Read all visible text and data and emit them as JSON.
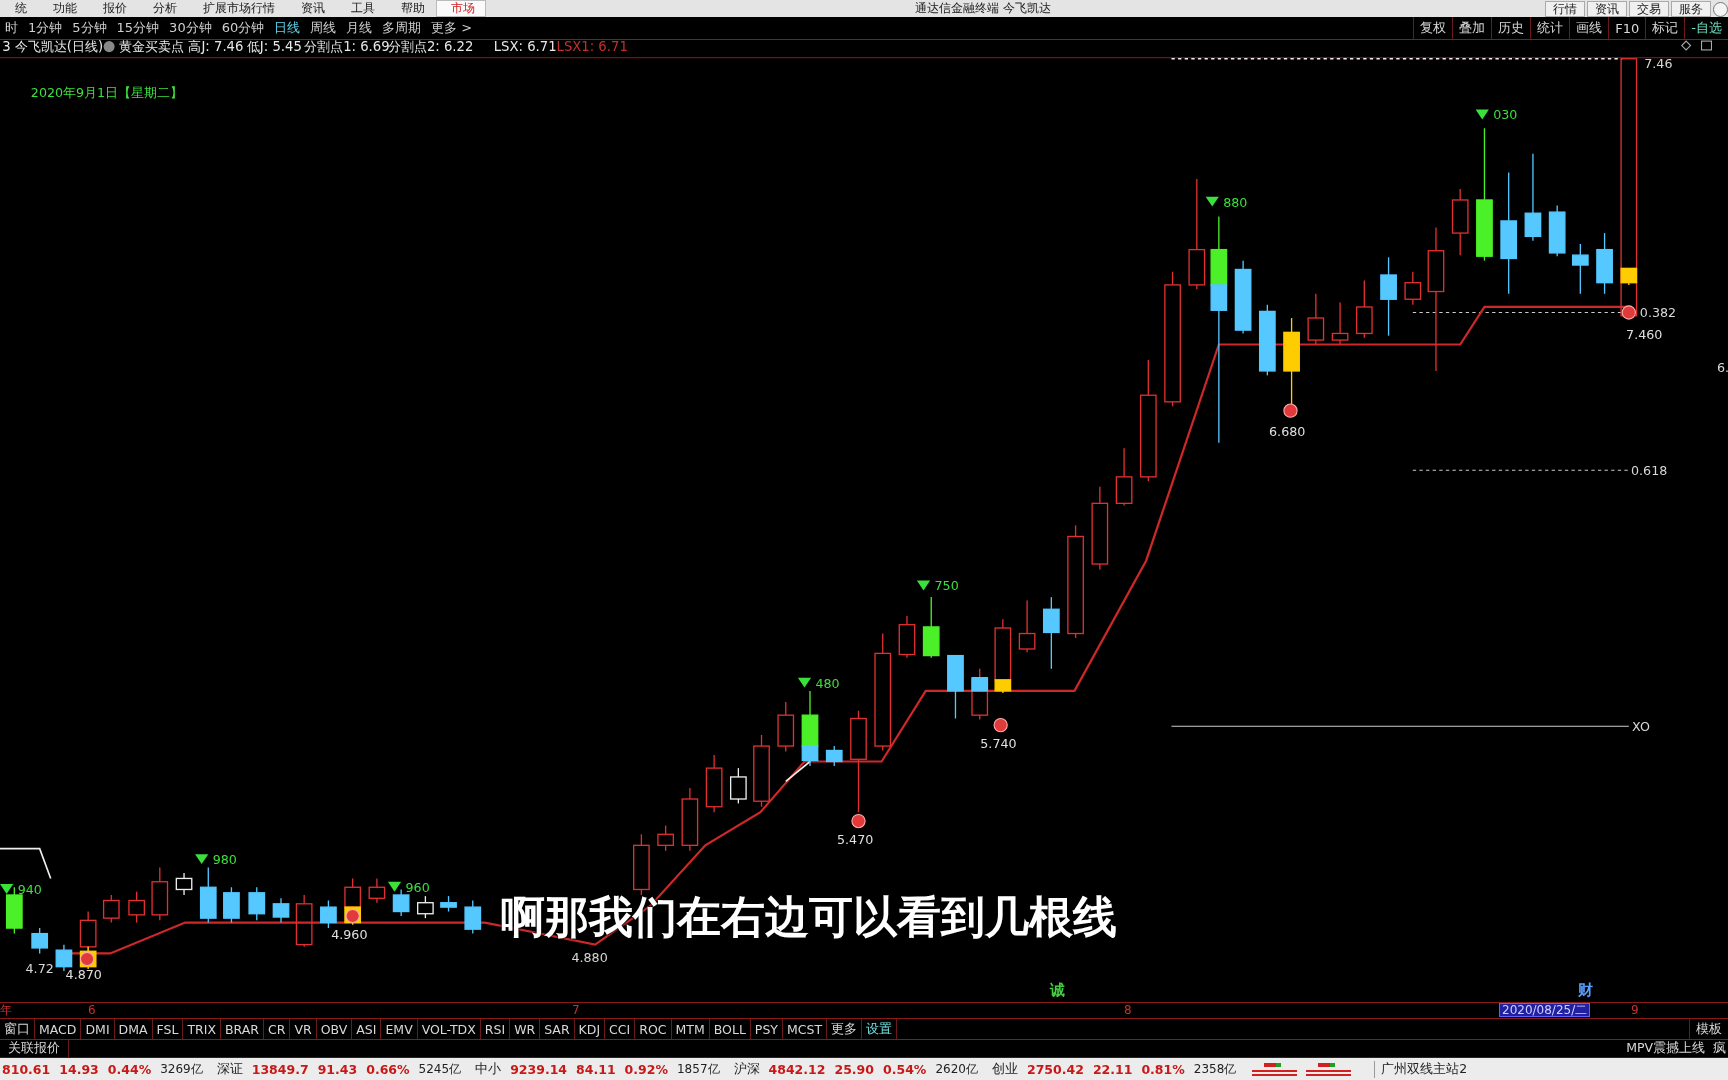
{
  "menu_bar": {
    "items": [
      {
        "label": "统",
        "selected": false
      },
      {
        "label": "功能",
        "selected": false
      },
      {
        "label": "报价",
        "selected": false
      },
      {
        "label": "分析",
        "selected": false
      },
      {
        "label": "扩展市场行情",
        "selected": false
      },
      {
        "label": "资讯",
        "selected": false
      },
      {
        "label": "工具",
        "selected": false
      },
      {
        "label": "帮助",
        "selected": false
      },
      {
        "label": "市场",
        "selected": true
      }
    ],
    "title": "通达信金融终端 今飞凯达",
    "right_buttons": [
      "行情",
      "资讯",
      "交易",
      "服务"
    ]
  },
  "period_bar": {
    "items": [
      {
        "label": "时",
        "selected": false
      },
      {
        "label": "1分钟",
        "selected": false
      },
      {
        "label": "5分钟",
        "selected": false
      },
      {
        "label": "15分钟",
        "selected": false
      },
      {
        "label": "30分钟",
        "selected": false
      },
      {
        "label": "60分钟",
        "selected": false
      },
      {
        "label": "日线",
        "selected": true
      },
      {
        "label": "周线",
        "selected": false
      },
      {
        "label": "月线",
        "selected": false
      },
      {
        "label": "多周期",
        "selected": false
      },
      {
        "label": "更多 >",
        "selected": false
      }
    ],
    "tools": [
      {
        "label": "复权",
        "kind": "plain"
      },
      {
        "label": "叠加",
        "kind": "plain"
      },
      {
        "label": "历史",
        "kind": "plain"
      },
      {
        "label": "统计",
        "kind": "plain"
      },
      {
        "label": "画线",
        "kind": "plain"
      },
      {
        "label": "F10",
        "kind": "plain"
      },
      {
        "label": "标记",
        "kind": "plain"
      },
      {
        "label": "-自选",
        "kind": "accent"
      }
    ]
  },
  "info_row": {
    "stock": "3 今飞凯达(日线)",
    "indicator": "黄金买卖点",
    "values": [
      {
        "text": "高J: 7.46",
        "color": "#e8e8e8"
      },
      {
        "text": "低J: 5.45",
        "color": "#e8e8e8"
      },
      {
        "text": "分割点1: 6.69",
        "color": "#e8e8e8"
      },
      {
        "text": "分割点2: 6.22",
        "color": "#e8e8e8"
      },
      {
        "text": "LSX: 6.71",
        "color": "#e8e8e8"
      },
      {
        "text": "LSX1: 6.71",
        "color": "#c03030"
      }
    ]
  },
  "chart": {
    "date_label": "2020年9月1日【星期二】",
    "labels": [
      {
        "kind": "high",
        "text": "030"
      },
      {
        "kind": "high",
        "text": "880"
      },
      {
        "kind": "high",
        "text": "750"
      },
      {
        "kind": "high",
        "text": "480"
      },
      {
        "kind": "high",
        "text": "980"
      },
      {
        "kind": "high",
        "text": "960"
      },
      {
        "kind": "high",
        "text": "940"
      },
      {
        "kind": "low",
        "text": "6.680"
      },
      {
        "kind": "low",
        "text": "5.740"
      },
      {
        "kind": "low",
        "text": "5.470"
      },
      {
        "kind": "low",
        "text": "4.960"
      },
      {
        "kind": "low",
        "text": "4.870"
      },
      {
        "kind": "plain",
        "text": "4.880"
      },
      {
        "kind": "plain",
        "text": "4.72"
      },
      {
        "kind": "plain",
        "text": "7.46"
      },
      {
        "kind": "plain",
        "text": "0.382"
      },
      {
        "kind": "low",
        "text": "7.460"
      },
      {
        "kind": "plain",
        "text": "0.618"
      },
      {
        "kind": "plain",
        "text": "XO"
      },
      {
        "kind": "plain",
        "text": "6."
      }
    ],
    "caption": "啊那我们在右边可以看到几根线",
    "event_marks": [
      {
        "text": "诚",
        "color": "#44cc44"
      },
      {
        "text": "财",
        "color": "#5aa0ff"
      }
    ]
  },
  "time_axis": {
    "ticks": [
      "年",
      "6",
      "7",
      "8",
      "9"
    ],
    "cursor_date": "2020/08/25/二"
  },
  "indicator_tabs": {
    "items": [
      {
        "label": "窗口",
        "kind": "plain"
      },
      {
        "label": "MACD",
        "kind": "plain"
      },
      {
        "label": "DMI",
        "kind": "plain"
      },
      {
        "label": "DMA",
        "kind": "plain"
      },
      {
        "label": "FSL",
        "kind": "plain"
      },
      {
        "label": "TRIX",
        "kind": "plain"
      },
      {
        "label": "BRAR",
        "kind": "plain"
      },
      {
        "label": "CR",
        "kind": "plain"
      },
      {
        "label": "VR",
        "kind": "plain"
      },
      {
        "label": "OBV",
        "kind": "plain"
      },
      {
        "label": "ASI",
        "kind": "plain"
      },
      {
        "label": "EMV",
        "kind": "plain"
      },
      {
        "label": "VOL-TDX",
        "kind": "plain"
      },
      {
        "label": "RSI",
        "kind": "plain"
      },
      {
        "label": "WR",
        "kind": "plain"
      },
      {
        "label": "SAR",
        "kind": "plain"
      },
      {
        "label": "KDJ",
        "kind": "plain"
      },
      {
        "label": "CCI",
        "kind": "plain"
      },
      {
        "label": "ROC",
        "kind": "plain"
      },
      {
        "label": "MTM",
        "kind": "plain"
      },
      {
        "label": "BOLL",
        "kind": "plain"
      },
      {
        "label": "PSY",
        "kind": "plain"
      },
      {
        "label": "MCST",
        "kind": "plain"
      },
      {
        "label": "更多",
        "kind": "plain"
      },
      {
        "label": "设置",
        "kind": "accent"
      }
    ],
    "right": "模板"
  },
  "quote_row": {
    "left": "关联报价",
    "right": [
      "MPV震撼上线",
      "疯"
    ]
  },
  "status_bar": {
    "indexes": [
      {
        "value": "810.61",
        "change": "14.93",
        "percent": "0.44%",
        "amount": "3269亿"
      },
      {
        "name": "深证",
        "value": "13849.7",
        "change": "91.43",
        "percent": "0.66%",
        "amount": "5245亿"
      },
      {
        "name": "中小",
        "value": "9239.14",
        "change": "84.11",
        "percent": "0.92%",
        "amount": "1857亿"
      },
      {
        "name": "沪深",
        "value": "4842.12",
        "change": "25.90",
        "percent": "0.54%",
        "amount": "2620亿"
      },
      {
        "name": "创业",
        "value": "2750.42",
        "change": "22.11",
        "percent": "0.81%",
        "amount": "2358亿"
      }
    ],
    "server": "广州双线主站2"
  }
}
